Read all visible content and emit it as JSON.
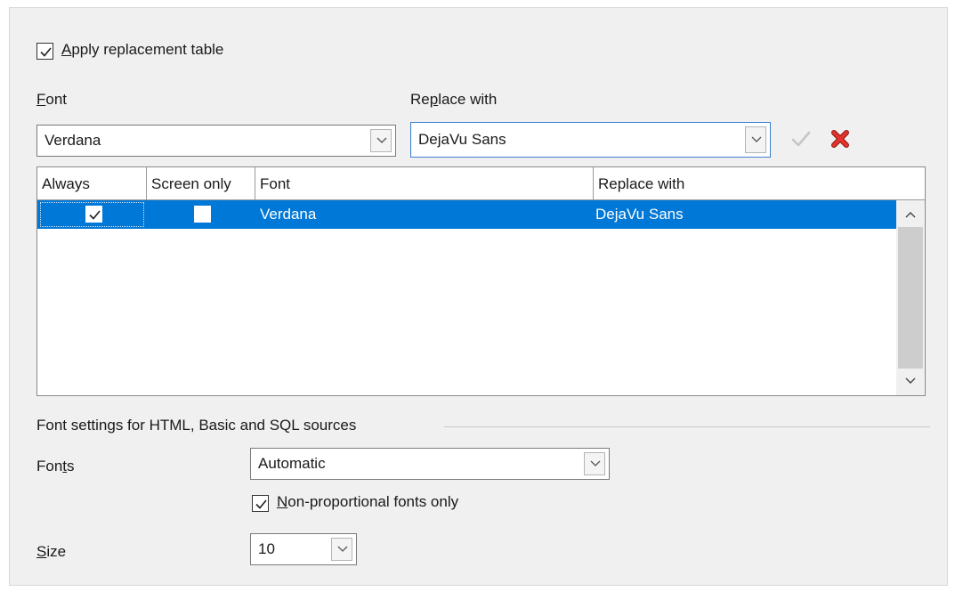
{
  "apply_replacement": {
    "label": "Apply replacement table",
    "checked": true
  },
  "font": {
    "label": "Font",
    "value": "Verdana"
  },
  "replace": {
    "label": "Replace with",
    "value": "DejaVu Sans"
  },
  "actions": {
    "apply_icon": "checkmark-icon",
    "delete_icon": "delete-x-icon",
    "delete_color": "#d9261c"
  },
  "table": {
    "headers": [
      "Always",
      "Screen only",
      "Font",
      "Replace with"
    ],
    "rows": [
      {
        "always": true,
        "screen_only": false,
        "font": "Verdana",
        "replace_with": "DejaVu Sans",
        "selected": true
      }
    ]
  },
  "source_section": {
    "title": "Font settings for HTML, Basic and SQL sources",
    "fonts_label": "Fonts",
    "fonts_value": "Automatic",
    "nonprop": {
      "label": "Non-proportional fonts only",
      "checked": true
    },
    "size_label": "Size",
    "size_value": "10"
  },
  "colors": {
    "selection": "#0078d7",
    "panel": "#f0f0f0"
  }
}
